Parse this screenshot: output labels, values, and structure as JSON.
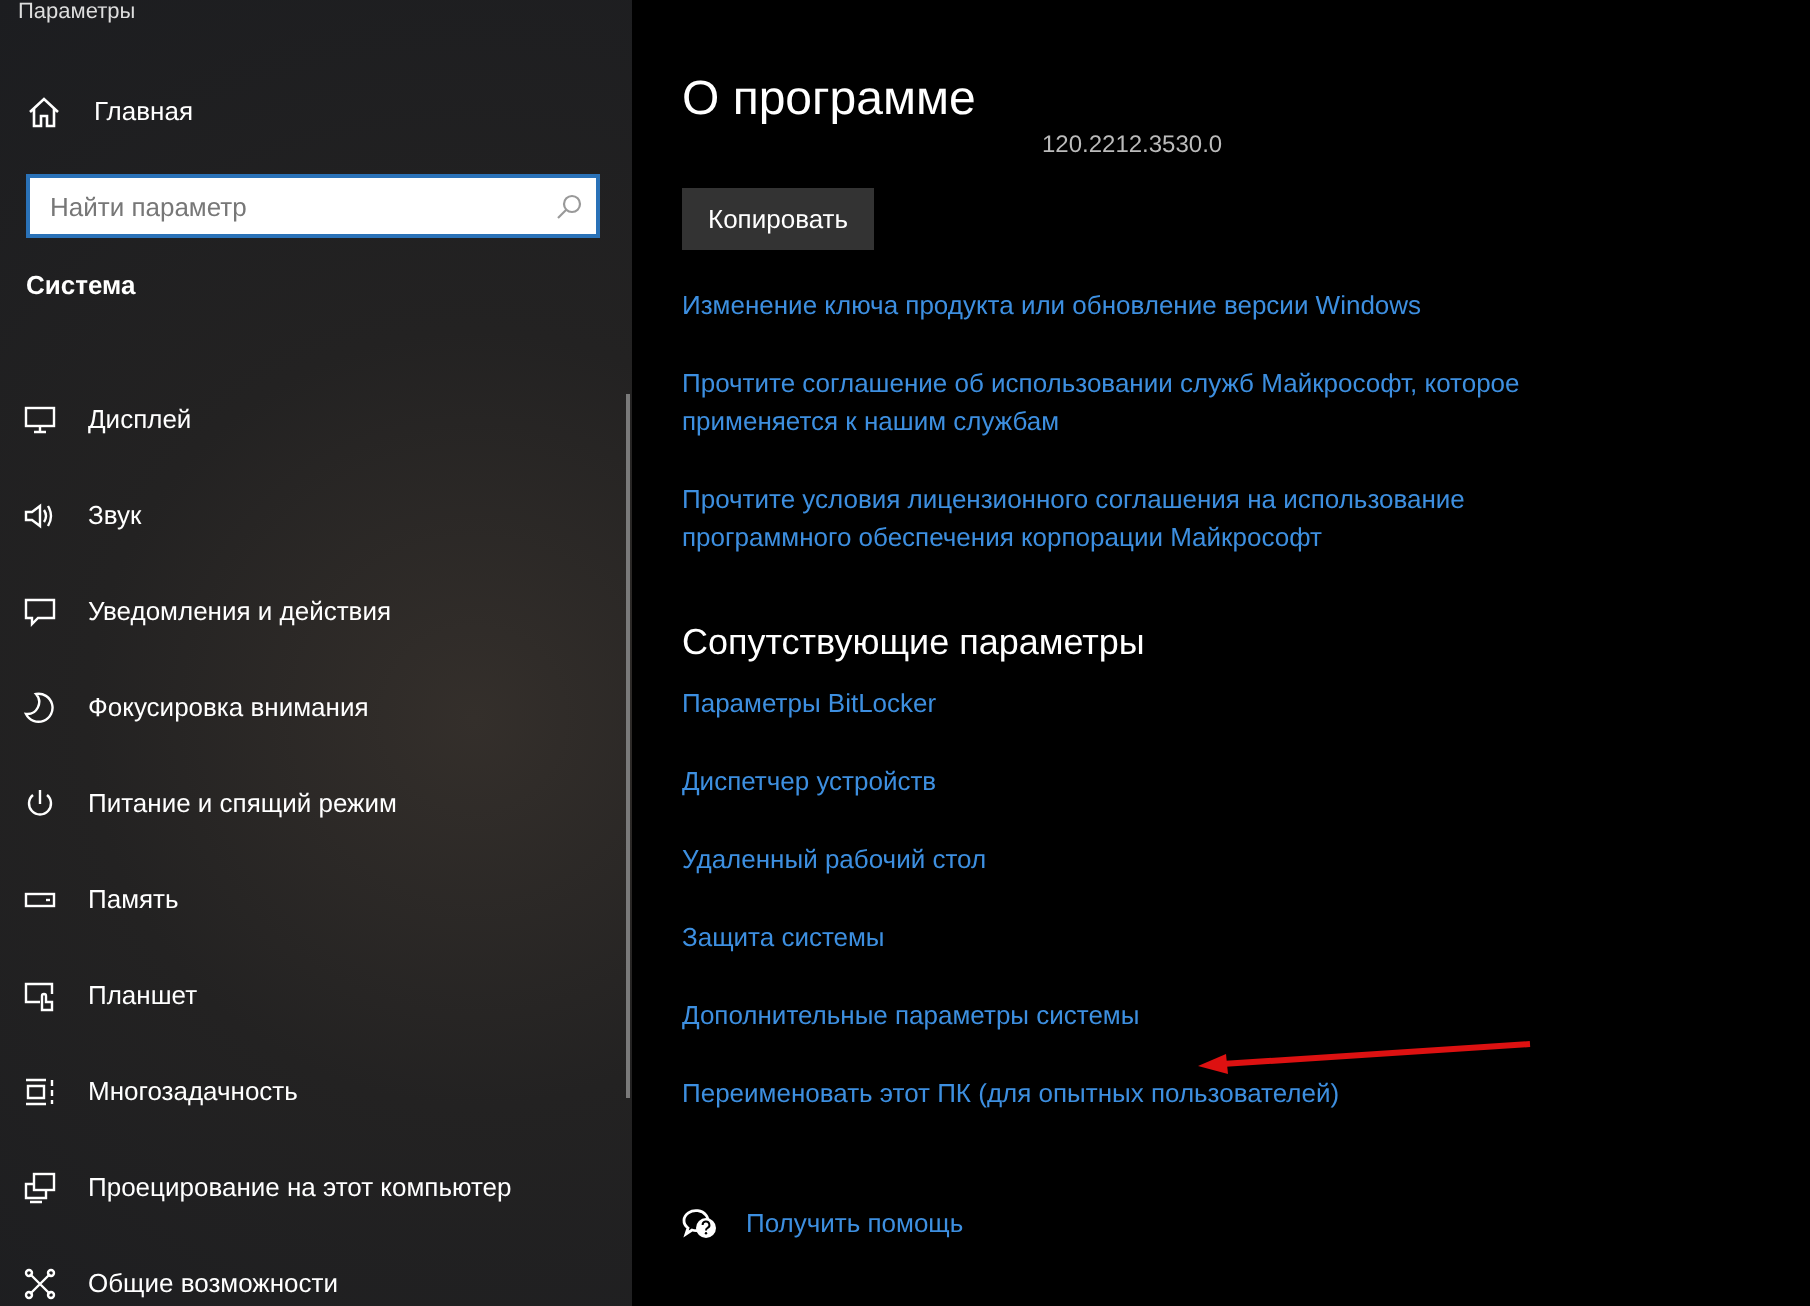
{
  "window": {
    "title": "Параметры"
  },
  "sidebar": {
    "home": "Главная",
    "search": {
      "placeholder": "Найти параметр"
    },
    "section": "Система",
    "items": [
      {
        "label": "Дисплей",
        "kind": "display"
      },
      {
        "label": "Звук",
        "kind": "sound"
      },
      {
        "label": "Уведомления и действия",
        "kind": "notifications"
      },
      {
        "label": "Фокусировка внимания",
        "kind": "focus"
      },
      {
        "label": "Питание и спящий режим",
        "kind": "power"
      },
      {
        "label": "Память",
        "kind": "storage"
      },
      {
        "label": "Планшет",
        "kind": "tablet"
      },
      {
        "label": "Многозадачность",
        "kind": "multitasking"
      },
      {
        "label": "Проецирование на этот компьютер",
        "kind": "projecting"
      },
      {
        "label": "Общие возможности",
        "kind": "accessibility"
      }
    ]
  },
  "main": {
    "title": "О программе",
    "version": "120.2212.3530.0",
    "copy_button": "Копировать",
    "links": [
      "Изменение ключа продукта или обновление версии Windows",
      "Прочтите соглашение об использовании служб Майкрософт, которое применяется к нашим службам",
      "Прочтите условия лицензионного соглашения на использование программного обеспечения корпорации Майкрософт"
    ],
    "related_title": "Сопутствующие параметры",
    "related_links": [
      "Параметры BitLocker",
      "Диспетчер устройств",
      "Удаленный рабочий стол",
      "Защита системы",
      "Дополнительные параметры системы",
      "Переименовать этот ПК (для опытных пользователей)"
    ],
    "help": "Получить помощь"
  }
}
